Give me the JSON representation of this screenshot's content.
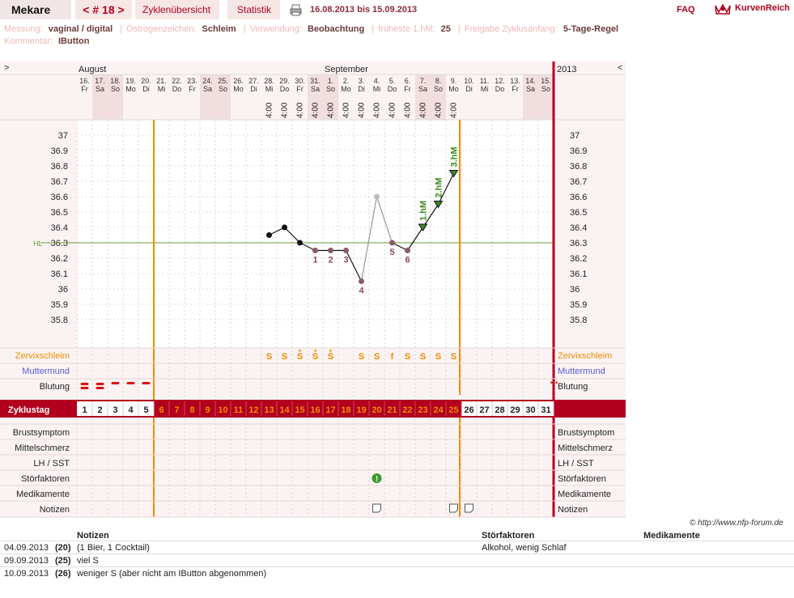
{
  "topbar": {
    "user": "Mekare",
    "cycle_nav": "< # 18 >",
    "cycle_overview": "Zyklenübersicht",
    "statistics": "Statistik",
    "print_icon": "printer-icon",
    "date_range": "16.08.2013 bis 15.09.2013",
    "faq": "FAQ",
    "logo_icon": "crown-icon",
    "brand": "KurvenReich"
  },
  "info": {
    "measurement_label": "Messung:",
    "measurement_value": "vaginal / digital",
    "estrogen_label": "Östrogenzeichen:",
    "estrogen_value": "Schleim",
    "usage_label": "Verwendung:",
    "usage_value": "Beobachtung",
    "earliest_label": "früheste 1.hM:",
    "earliest_value": "25",
    "release_label": "Freigabe Zyklusanfang:",
    "release_value": "5-Tage-Regel",
    "comment_label": "Kommentar:",
    "comment_value": "IButton"
  },
  "chart": {
    "nav_left": ">",
    "nav_right": "<",
    "month_aug": "August",
    "month_sep": "September",
    "year": "2013",
    "hl_label": "HL",
    "hl_value": 36.3,
    "temps_axis": [
      "37",
      "36.9",
      "36.8",
      "36.7",
      "36.6",
      "36.5",
      "36.4",
      "36.3",
      "36.2",
      "36.1",
      "36",
      "35.9",
      "35.8"
    ],
    "dates": [
      "16.",
      "17.",
      "18.",
      "19.",
      "20.",
      "21.",
      "22.",
      "23.",
      "24.",
      "25.",
      "26.",
      "27.",
      "28.",
      "29.",
      "30.",
      "31.",
      "1.",
      "2.",
      "3.",
      "4.",
      "5.",
      "6.",
      "7.",
      "8.",
      "9.",
      "10.",
      "11.",
      "12.",
      "13.",
      "14.",
      "15."
    ],
    "weekdays": [
      "Fr",
      "Sa",
      "So",
      "Mo",
      "Di",
      "Mi",
      "Do",
      "Fr",
      "Sa",
      "So",
      "Mo",
      "Di",
      "Mi",
      "Do",
      "Fr",
      "Sa",
      "So",
      "Mo",
      "Di",
      "Mi",
      "Do",
      "Fr",
      "Sa",
      "So",
      "Mo",
      "Di",
      "Mi",
      "Do",
      "Fr",
      "Sa",
      "So"
    ],
    "times": [
      "",
      "",
      "",
      "",
      "",
      "",
      "",
      "",
      "",
      "",
      "",
      "",
      "4:00",
      "4:00",
      "4:00",
      "4:00",
      "4:00",
      "4:00",
      "4:00",
      "4:00",
      "4:00",
      "4:00",
      "4:00",
      "4:00",
      "4:00",
      "",
      "",
      "",
      "",
      "",
      ""
    ],
    "cycle_days": [
      "1",
      "2",
      "3",
      "4",
      "5",
      "6",
      "7",
      "8",
      "9",
      "10",
      "11",
      "12",
      "13",
      "14",
      "15",
      "16",
      "17",
      "18",
      "19",
      "20",
      "21",
      "22",
      "23",
      "24",
      "25",
      "26",
      "27",
      "28",
      "29",
      "30",
      "31"
    ],
    "cycle_day_label": "Zyklustag",
    "temperatures": [
      null,
      null,
      null,
      null,
      null,
      null,
      null,
      null,
      null,
      null,
      null,
      null,
      36.35,
      36.4,
      36.3,
      36.25,
      36.25,
      36.25,
      36.05,
      36.6,
      36.3,
      36.25,
      36.4,
      36.55,
      36.75,
      null,
      null,
      null,
      null,
      null,
      null
    ],
    "excluded_days": [
      20
    ],
    "low_numbers": [
      {
        "day": 16,
        "label": "1"
      },
      {
        "day": 17,
        "label": "2"
      },
      {
        "day": 18,
        "label": "3"
      },
      {
        "day": 19,
        "label": "4"
      },
      {
        "day": 21,
        "label": "5"
      },
      {
        "day": 22,
        "label": "6"
      }
    ],
    "high_labels": [
      {
        "day": 23,
        "label": "1.hM"
      },
      {
        "day": 24,
        "label": "2.hM"
      },
      {
        "day": 25,
        "label": "3.hM"
      }
    ],
    "mucus": [
      "",
      "",
      "",
      "",
      "",
      "",
      "",
      "",
      "",
      "",
      "",
      "",
      "S",
      "S",
      "S+",
      "S+",
      "S+",
      "",
      "S",
      "S",
      "f",
      "S",
      "S",
      "S",
      "S",
      "",
      "",
      "",
      "",
      "",
      ""
    ],
    "bleeding": [
      "heavy",
      "heavy",
      "light",
      "light",
      "light",
      "",
      "",
      "",
      "",
      "",
      "",
      "",
      "",
      "",
      "",
      "",
      "",
      "",
      "",
      "",
      "",
      "",
      "",
      "",
      "",
      "",
      "",
      "",
      "",
      "",
      "spot"
    ],
    "disturbance_day": 20,
    "note_days": [
      20,
      25,
      26
    ],
    "rows_left": [
      "Zervixschleim",
      "Muttermund",
      "Blutung"
    ],
    "rows_bottom": [
      "Brustsymptom",
      "Mittelschmerz",
      "LH / SST",
      "Störfaktoren",
      "Medikamente",
      "Notizen"
    ],
    "colors": {
      "accent": "#b3001e",
      "orange": "#f08a00",
      "blue": "#5a5ad8",
      "hl": "#6a9a3a",
      "high": "#3a8a1a"
    }
  },
  "credit": "© http://www.nfp-forum.de",
  "notes_table": {
    "headers": {
      "notes": "Notizen",
      "disturbances": "Störfaktoren",
      "medications": "Medikamente"
    },
    "rows": [
      {
        "date": "04.09.2013",
        "day": "(20)",
        "note": "(1 Bier, 1 Cocktail)",
        "disturbance": "Alkohol, wenig Schlaf"
      },
      {
        "date": "09.09.2013",
        "day": "(25)",
        "note": "viel S",
        "disturbance": ""
      },
      {
        "date": "10.09.2013",
        "day": "(26)",
        "note": "weniger S (aber nicht am IButton abgenommen)",
        "disturbance": ""
      }
    ]
  }
}
